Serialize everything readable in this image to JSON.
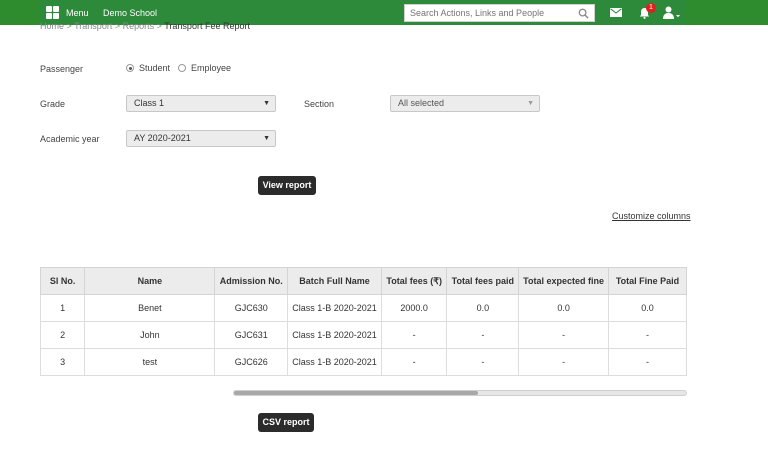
{
  "topbar": {
    "menu_label": "Menu",
    "school_name": "Demo School",
    "search_placeholder": "Search Actions, Links and People",
    "notification_count": "1",
    "brand_color": "#2c8a3a"
  },
  "breadcrumb": {
    "items": [
      "Home",
      "Transport",
      "Reports"
    ],
    "separator": ">",
    "current": "Transport Fee Report"
  },
  "form": {
    "passenger_label": "Passenger",
    "passenger_options": [
      {
        "label": "Student",
        "selected": true
      },
      {
        "label": "Employee",
        "selected": false
      }
    ],
    "grade_label": "Grade",
    "grade_value": "Class 1",
    "section_label": "Section",
    "section_value": "All selected",
    "academic_year_label": "Academic year",
    "academic_year_value": "AY 2020-2021",
    "view_report_label": "View report"
  },
  "customize_columns_label": "Customize columns",
  "table": {
    "headers": [
      "Sl No.",
      "Name",
      "Admission No.",
      "Batch Full Name",
      "Total fees (₹)",
      "Total fees paid",
      "Total expected fine",
      "Total Fine Paid"
    ],
    "rows": [
      [
        "1",
        "Benet",
        "GJC630",
        "Class 1-B 2020-2021",
        "2000.0",
        "0.0",
        "0.0",
        "0.0"
      ],
      [
        "2",
        "John",
        "GJC631",
        "Class 1-B 2020-2021",
        "-",
        "-",
        "-",
        "-"
      ],
      [
        "3",
        "test",
        "GJC626",
        "Class 1-B 2020-2021",
        "-",
        "-",
        "-",
        "-"
      ]
    ]
  },
  "horizontal_scroll_fraction": 0.54,
  "csv_report_label": "CSV report",
  "icons": {
    "menu": "grid-icon",
    "search": "search-icon",
    "mail": "mail-icon",
    "notifications": "bell-icon",
    "user": "user-icon"
  }
}
